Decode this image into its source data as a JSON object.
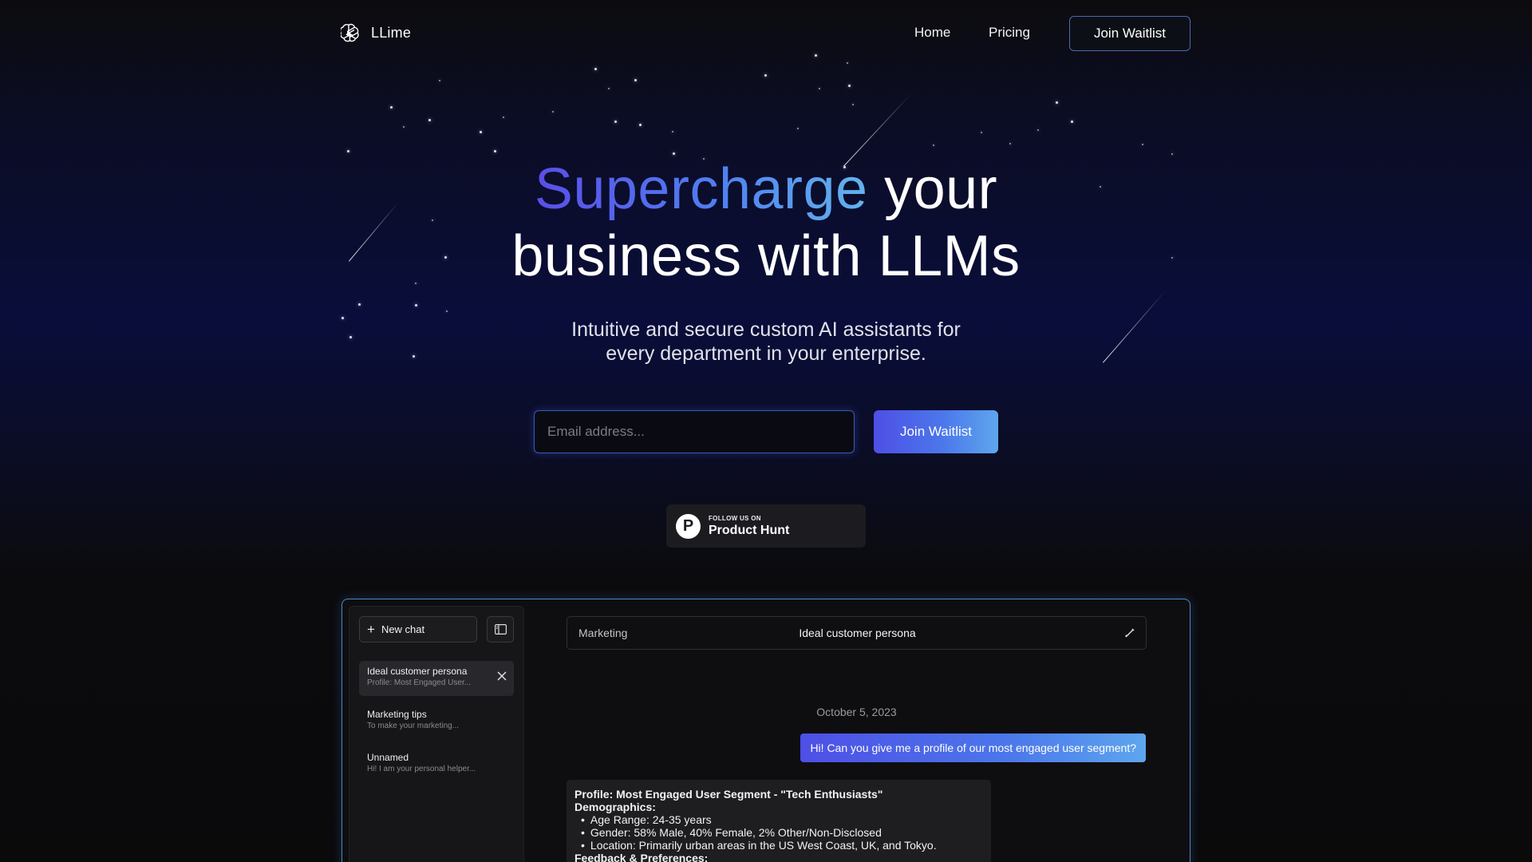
{
  "nav": {
    "brand": "LLime",
    "links": [
      "Home",
      "Pricing"
    ],
    "cta": "Join Waitlist"
  },
  "hero": {
    "title_accent": "Supercharge",
    "title_rest_1": " your",
    "title_line_2": "business with LLMs",
    "subtitle_line_1": "Intuitive and secure custom AI assistants for",
    "subtitle_line_2": "every department in your enterprise.",
    "email_placeholder": "Email address...",
    "join_button": "Join Waitlist"
  },
  "product_hunt": {
    "small": "FOLLOW US ON",
    "big": "Product Hunt",
    "logo_letter": "P"
  },
  "app": {
    "new_chat": "New chat",
    "chats": [
      {
        "title": "Ideal customer persona",
        "preview": "Profile: Most Engaged User..."
      },
      {
        "title": "Marketing tips",
        "preview": "To make your marketing..."
      },
      {
        "title": "Unnamed",
        "preview": "Hi! I am your personal helper..."
      }
    ],
    "department": "Marketing",
    "conversation_title": "Ideal customer persona",
    "date": "October 5, 2023",
    "user_message": "Hi! Can you give me a profile of our most engaged user segment?",
    "reply": {
      "heading": "Profile: Most Engaged User Segment - \"Tech Enthusiasts\"",
      "demographics_label": "Demographics:",
      "demographics": [
        "Age Range: 24-35 years",
        "Gender: 58% Male, 40% Female, 2% Other/Non-Disclosed",
        "Location: Primarily urban areas in the US West Coast, UK, and Tokyo."
      ],
      "feedback_label": "Feedback & Preferences:"
    }
  },
  "colors": {
    "accent_gradient_start": "#4e4fe6",
    "accent_gradient_end": "#5ea6ee",
    "background": "#0a0d3a"
  }
}
